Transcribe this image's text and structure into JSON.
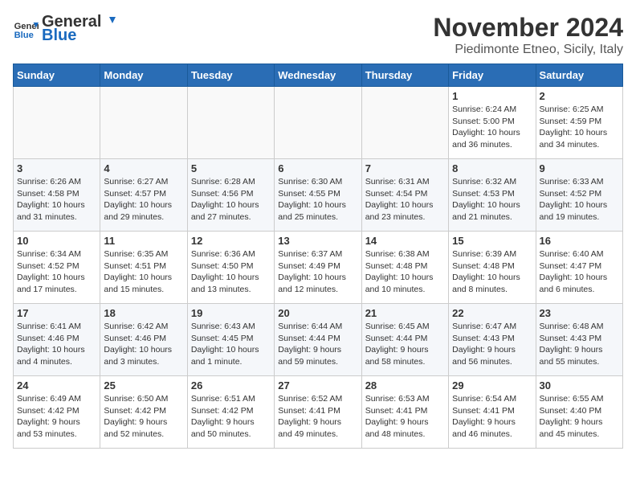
{
  "header": {
    "logo_general": "General",
    "logo_blue": "Blue",
    "month": "November 2024",
    "location": "Piedimonte Etneo, Sicily, Italy"
  },
  "weekdays": [
    "Sunday",
    "Monday",
    "Tuesday",
    "Wednesday",
    "Thursday",
    "Friday",
    "Saturday"
  ],
  "weeks": [
    [
      {
        "day": "",
        "info": ""
      },
      {
        "day": "",
        "info": ""
      },
      {
        "day": "",
        "info": ""
      },
      {
        "day": "",
        "info": ""
      },
      {
        "day": "",
        "info": ""
      },
      {
        "day": "1",
        "info": "Sunrise: 6:24 AM\nSunset: 5:00 PM\nDaylight: 10 hours\nand 36 minutes."
      },
      {
        "day": "2",
        "info": "Sunrise: 6:25 AM\nSunset: 4:59 PM\nDaylight: 10 hours\nand 34 minutes."
      }
    ],
    [
      {
        "day": "3",
        "info": "Sunrise: 6:26 AM\nSunset: 4:58 PM\nDaylight: 10 hours\nand 31 minutes."
      },
      {
        "day": "4",
        "info": "Sunrise: 6:27 AM\nSunset: 4:57 PM\nDaylight: 10 hours\nand 29 minutes."
      },
      {
        "day": "5",
        "info": "Sunrise: 6:28 AM\nSunset: 4:56 PM\nDaylight: 10 hours\nand 27 minutes."
      },
      {
        "day": "6",
        "info": "Sunrise: 6:30 AM\nSunset: 4:55 PM\nDaylight: 10 hours\nand 25 minutes."
      },
      {
        "day": "7",
        "info": "Sunrise: 6:31 AM\nSunset: 4:54 PM\nDaylight: 10 hours\nand 23 minutes."
      },
      {
        "day": "8",
        "info": "Sunrise: 6:32 AM\nSunset: 4:53 PM\nDaylight: 10 hours\nand 21 minutes."
      },
      {
        "day": "9",
        "info": "Sunrise: 6:33 AM\nSunset: 4:52 PM\nDaylight: 10 hours\nand 19 minutes."
      }
    ],
    [
      {
        "day": "10",
        "info": "Sunrise: 6:34 AM\nSunset: 4:52 PM\nDaylight: 10 hours\nand 17 minutes."
      },
      {
        "day": "11",
        "info": "Sunrise: 6:35 AM\nSunset: 4:51 PM\nDaylight: 10 hours\nand 15 minutes."
      },
      {
        "day": "12",
        "info": "Sunrise: 6:36 AM\nSunset: 4:50 PM\nDaylight: 10 hours\nand 13 minutes."
      },
      {
        "day": "13",
        "info": "Sunrise: 6:37 AM\nSunset: 4:49 PM\nDaylight: 10 hours\nand 12 minutes."
      },
      {
        "day": "14",
        "info": "Sunrise: 6:38 AM\nSunset: 4:48 PM\nDaylight: 10 hours\nand 10 minutes."
      },
      {
        "day": "15",
        "info": "Sunrise: 6:39 AM\nSunset: 4:48 PM\nDaylight: 10 hours\nand 8 minutes."
      },
      {
        "day": "16",
        "info": "Sunrise: 6:40 AM\nSunset: 4:47 PM\nDaylight: 10 hours\nand 6 minutes."
      }
    ],
    [
      {
        "day": "17",
        "info": "Sunrise: 6:41 AM\nSunset: 4:46 PM\nDaylight: 10 hours\nand 4 minutes."
      },
      {
        "day": "18",
        "info": "Sunrise: 6:42 AM\nSunset: 4:46 PM\nDaylight: 10 hours\nand 3 minutes."
      },
      {
        "day": "19",
        "info": "Sunrise: 6:43 AM\nSunset: 4:45 PM\nDaylight: 10 hours\nand 1 minute."
      },
      {
        "day": "20",
        "info": "Sunrise: 6:44 AM\nSunset: 4:44 PM\nDaylight: 9 hours\nand 59 minutes."
      },
      {
        "day": "21",
        "info": "Sunrise: 6:45 AM\nSunset: 4:44 PM\nDaylight: 9 hours\nand 58 minutes."
      },
      {
        "day": "22",
        "info": "Sunrise: 6:47 AM\nSunset: 4:43 PM\nDaylight: 9 hours\nand 56 minutes."
      },
      {
        "day": "23",
        "info": "Sunrise: 6:48 AM\nSunset: 4:43 PM\nDaylight: 9 hours\nand 55 minutes."
      }
    ],
    [
      {
        "day": "24",
        "info": "Sunrise: 6:49 AM\nSunset: 4:42 PM\nDaylight: 9 hours\nand 53 minutes."
      },
      {
        "day": "25",
        "info": "Sunrise: 6:50 AM\nSunset: 4:42 PM\nDaylight: 9 hours\nand 52 minutes."
      },
      {
        "day": "26",
        "info": "Sunrise: 6:51 AM\nSunset: 4:42 PM\nDaylight: 9 hours\nand 50 minutes."
      },
      {
        "day": "27",
        "info": "Sunrise: 6:52 AM\nSunset: 4:41 PM\nDaylight: 9 hours\nand 49 minutes."
      },
      {
        "day": "28",
        "info": "Sunrise: 6:53 AM\nSunset: 4:41 PM\nDaylight: 9 hours\nand 48 minutes."
      },
      {
        "day": "29",
        "info": "Sunrise: 6:54 AM\nSunset: 4:41 PM\nDaylight: 9 hours\nand 46 minutes."
      },
      {
        "day": "30",
        "info": "Sunrise: 6:55 AM\nSunset: 4:40 PM\nDaylight: 9 hours\nand 45 minutes."
      }
    ]
  ]
}
